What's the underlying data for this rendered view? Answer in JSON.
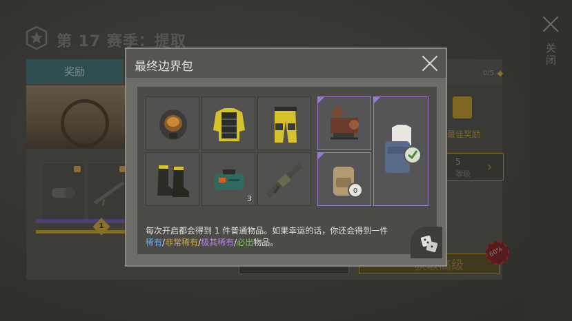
{
  "background": {
    "season_title": "第 17 赛季：提取",
    "tab_label": "奖励",
    "close_label": "关闭",
    "counter": "0/5",
    "best_reward_label": "最佳奖励",
    "level_number": "5",
    "level_label": "等级",
    "bonus_button_label": "获取高级",
    "sale_badge": "60%",
    "track_level": "1"
  },
  "dialog": {
    "title": "最终边界包",
    "items": [
      {
        "name": "helmet",
        "icon": "gas-mask-helmet-icon",
        "count": ""
      },
      {
        "name": "jacket",
        "icon": "yellow-armor-jacket-icon",
        "count": ""
      },
      {
        "name": "pants",
        "icon": "yellow-pants-icon",
        "count": ""
      },
      {
        "name": "boots",
        "icon": "boots-icon",
        "count": ""
      },
      {
        "name": "medkit",
        "icon": "medkit-icon",
        "count": "3"
      },
      {
        "name": "launcher",
        "icon": "grenade-launcher-icon",
        "count": ""
      },
      {
        "name": "machine",
        "icon": "workbench-machine-icon",
        "count": ""
      },
      {
        "name": "backpack",
        "icon": "backpack-icon",
        "count": ""
      },
      {
        "name": "outfit",
        "icon": "outfit-bundle-icon",
        "count": ""
      }
    ],
    "description": {
      "line1": "每次开启都会得到 1 件普通物品。如果幸运的话，你还会得到一件",
      "rare": "稀有",
      "sep1": "/",
      "very_rare": "非常稀有",
      "sep2": "/",
      "epic": "极其稀有",
      "sep3": "/",
      "guaranteed": "必出",
      "suffix": "物品。"
    },
    "colors": {
      "rare": "#6fa3dd",
      "very_rare": "#c8a84a",
      "epic": "#b087e0",
      "guaranteed": "#7cc24c",
      "rare_border": "#9b7bd0"
    }
  }
}
